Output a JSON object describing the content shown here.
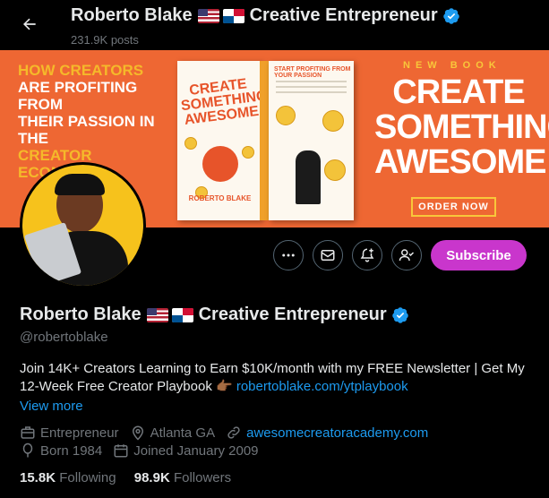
{
  "header": {
    "name": "Roberto Blake",
    "name_suffix": "Creative Entrepreneur",
    "posts": "231.9K posts",
    "back_icon": "arrow-left-icon"
  },
  "banner": {
    "left_line1": "HOW CREATORS",
    "left_line2": "ARE PROFITING FROM",
    "left_line3": "THEIR PASSION IN THE",
    "left_line4": "CREATOR ECONOMY",
    "book_title": "CREATE SOMETHING AWESOME",
    "book_author": "ROBERTO BLAKE",
    "back_cover_heading": "START PROFITING FROM YOUR PASSION",
    "new_book": "NEW BOOK",
    "big_line1": "CREATE",
    "big_line2": "SOMETHING",
    "big_line3": "AWESOME",
    "order_now": "ORDER NOW",
    "colors": {
      "background": "#ee6733",
      "accent": "#f5b92a"
    }
  },
  "actions": {
    "more_icon": "more-dots-icon",
    "message_icon": "mail-icon",
    "notify_icon": "bell-plus-icon",
    "follow_icon": "person-check-icon",
    "subscribe_label": "Subscribe",
    "subscribe_color": "#c936cc"
  },
  "profile": {
    "name": "Roberto Blake",
    "name_suffix": "Creative Entrepreneur",
    "handle": "@robertoblake",
    "bio_text": "Join 14K+ Creators Learning to Earn $10K/month with my FREE Newsletter | Get My 12-Week Free Creator Playbook 👉🏾 ",
    "bio_link": "robertoblake.com/ytplaybook",
    "view_more": "View more",
    "category": "Entrepreneur",
    "location": "Atlanta GA",
    "website": "awesomecreatoracademy.com",
    "born": "Born 1984",
    "joined": "Joined January 2009",
    "following_count": "15.8K",
    "following_label": "Following",
    "followers_count": "98.9K",
    "followers_label": "Followers",
    "link_color": "#1d9bf0"
  }
}
